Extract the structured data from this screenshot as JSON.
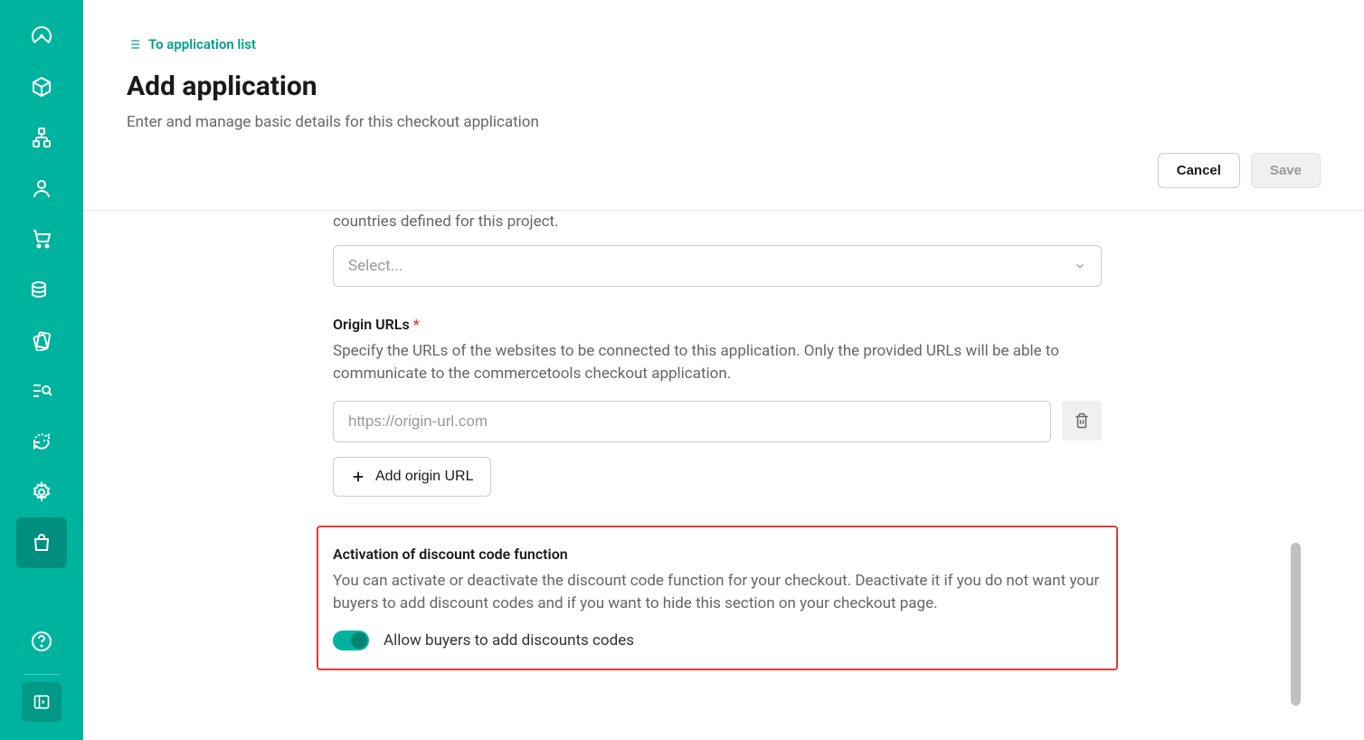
{
  "breadcrumb": {
    "label": "To application list"
  },
  "header": {
    "title": "Add application",
    "subtitle": "Enter and manage basic details for this checkout application",
    "cancel_label": "Cancel",
    "save_label": "Save"
  },
  "countries": {
    "help_partial": "countries defined for this project.",
    "select_placeholder": "Select..."
  },
  "origin_urls": {
    "label": "Origin URLs",
    "required": "*",
    "description": "Specify the URLs of the websites to be connected to this application. Only the provided URLs will be able to communicate to the commercetools checkout application.",
    "placeholder": "https://origin-url.com",
    "add_button": "Add origin URL"
  },
  "discount_section": {
    "title": "Activation of discount code function",
    "description": "You can activate or deactivate the discount code function for your checkout. Deactivate it if you do not want your buyers to add discount codes and if you want to hide this section on your checkout page.",
    "toggle_label": "Allow buyers to add discounts codes",
    "toggle_on": true
  }
}
